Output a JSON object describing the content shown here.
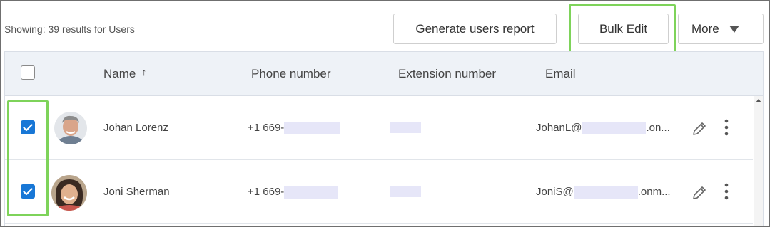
{
  "toolbar": {
    "results_text": "Showing: 39 results for Users",
    "generate_report_label": "Generate users report",
    "bulk_edit_label": "Bulk Edit",
    "more_label": "More"
  },
  "table": {
    "columns": [
      "Name",
      "Phone number",
      "Extension number",
      "Email"
    ],
    "sort_indicator": "↑",
    "rows": [
      {
        "name": "Johan Lorenz",
        "phone_prefix": "+1 669-",
        "email_prefix": "JohanL@",
        "email_suffix": ".on...",
        "checked": true
      },
      {
        "name": "Joni Sherman",
        "phone_prefix": "+1 669-",
        "email_prefix": "JoniS@",
        "email_suffix": ".onm...",
        "checked": true
      }
    ]
  },
  "colors": {
    "highlight": "#7ed35a",
    "checkbox_checked": "#1877d6",
    "header_bg": "#eef2f7",
    "redaction": "#e6e6f8"
  },
  "icons": {
    "sort": "arrow-up-icon",
    "more": "caret-down-icon",
    "edit": "pencil-icon",
    "menu": "kebab-menu-icon",
    "check": "checkmark-icon"
  }
}
